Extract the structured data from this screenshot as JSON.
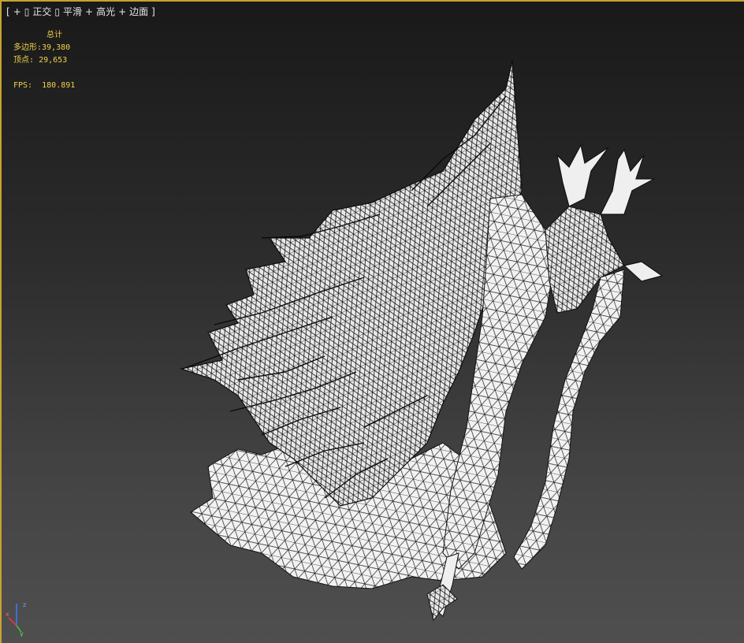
{
  "viewport": {
    "label": {
      "open": "[",
      "plus": "+",
      "view": "正交",
      "shading": "平滑",
      "highlight": "高光",
      "edges": "边面",
      "close": "]"
    }
  },
  "stats": {
    "heading": "总计",
    "polygons_label": "多边形:",
    "polygons_value": "39,380",
    "vertices_label": "顶点:",
    "vertices_value": "29,653",
    "fps_label": "FPS:",
    "fps_value": "180.891"
  },
  "axis": {
    "x": "x",
    "y": "y",
    "z": "z"
  },
  "colors": {
    "border": "#c8a230",
    "stats_text": "#f0d24a",
    "mesh_fill": "#f2f2f2",
    "mesh_wire": "#111111"
  }
}
